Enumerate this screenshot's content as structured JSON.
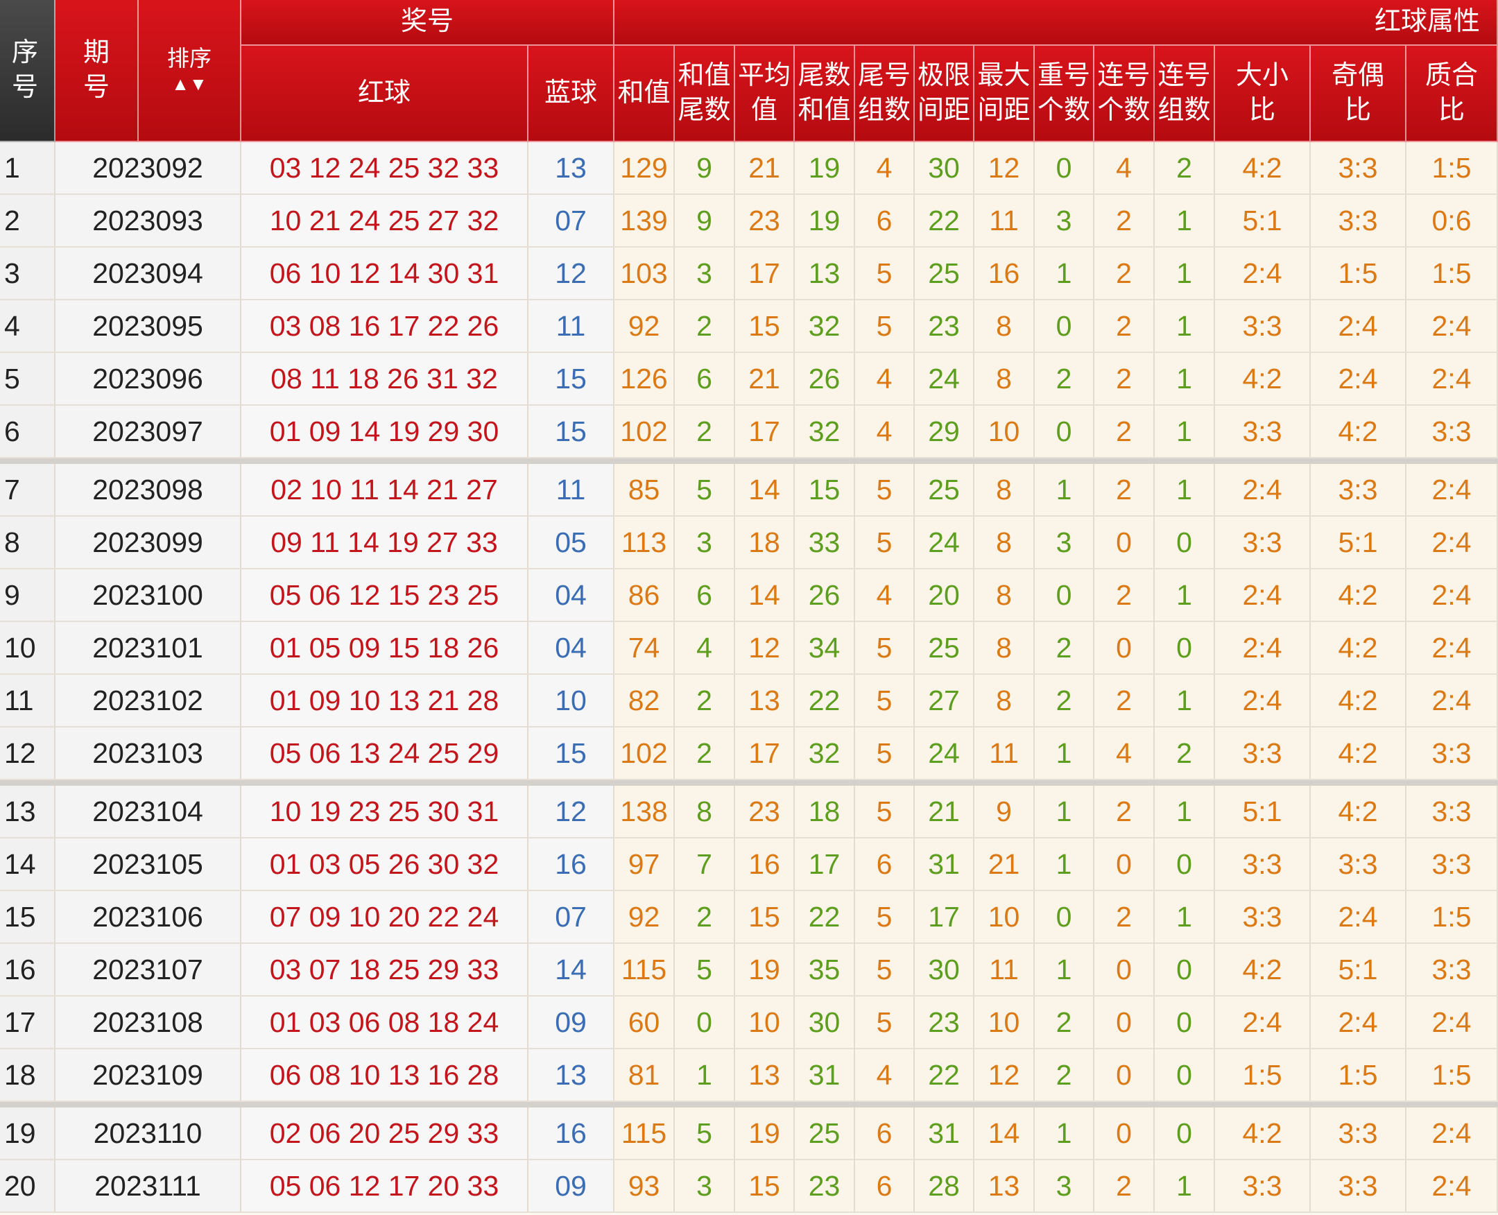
{
  "header": {
    "seq": "序号",
    "period": "期\n号",
    "sort": "排序",
    "sort_arrows": "▲▼",
    "prize": "奖号",
    "red": "红球",
    "blue": "蓝球",
    "attr_group": "红球属性",
    "attr_cols": [
      "和值",
      "和值\n尾数",
      "平均\n值",
      "尾数\n和值",
      "尾号\n组数",
      "极限\n间距",
      "最大\n间距",
      "重号\n个数",
      "连号\n个数",
      "连号\n组数",
      "大小\n比",
      "奇偶\n比",
      "质合\n比"
    ]
  },
  "rows": [
    {
      "seq": "1",
      "period": "2023092",
      "red": "03 12 24 25 32 33",
      "blue": "13",
      "attrs": [
        "129",
        "9",
        "21",
        "19",
        "4",
        "30",
        "12",
        "0",
        "4",
        "2",
        "4:2",
        "3:3",
        "1:5"
      ]
    },
    {
      "seq": "2",
      "period": "2023093",
      "red": "10 21 24 25 27 32",
      "blue": "07",
      "attrs": [
        "139",
        "9",
        "23",
        "19",
        "6",
        "22",
        "11",
        "3",
        "2",
        "1",
        "5:1",
        "3:3",
        "0:6"
      ]
    },
    {
      "seq": "3",
      "period": "2023094",
      "red": "06 10 12 14 30 31",
      "blue": "12",
      "attrs": [
        "103",
        "3",
        "17",
        "13",
        "5",
        "25",
        "16",
        "1",
        "2",
        "1",
        "2:4",
        "1:5",
        "1:5"
      ]
    },
    {
      "seq": "4",
      "period": "2023095",
      "red": "03 08 16 17 22 26",
      "blue": "11",
      "attrs": [
        "92",
        "2",
        "15",
        "32",
        "5",
        "23",
        "8",
        "0",
        "2",
        "1",
        "3:3",
        "2:4",
        "2:4"
      ]
    },
    {
      "seq": "5",
      "period": "2023096",
      "red": "08 11 18 26 31 32",
      "blue": "15",
      "attrs": [
        "126",
        "6",
        "21",
        "26",
        "4",
        "24",
        "8",
        "2",
        "2",
        "1",
        "4:2",
        "2:4",
        "2:4"
      ]
    },
    {
      "seq": "6",
      "period": "2023097",
      "red": "01 09 14 19 29 30",
      "blue": "15",
      "attrs": [
        "102",
        "2",
        "17",
        "32",
        "4",
        "29",
        "10",
        "0",
        "2",
        "1",
        "3:3",
        "4:2",
        "3:3"
      ]
    },
    {
      "seq": "7",
      "period": "2023098",
      "red": "02 10 11 14 21 27",
      "blue": "11",
      "attrs": [
        "85",
        "5",
        "14",
        "15",
        "5",
        "25",
        "8",
        "1",
        "2",
        "1",
        "2:4",
        "3:3",
        "2:4"
      ]
    },
    {
      "seq": "8",
      "period": "2023099",
      "red": "09 11 14 19 27 33",
      "blue": "05",
      "attrs": [
        "113",
        "3",
        "18",
        "33",
        "5",
        "24",
        "8",
        "3",
        "0",
        "0",
        "3:3",
        "5:1",
        "2:4"
      ]
    },
    {
      "seq": "9",
      "period": "2023100",
      "red": "05 06 12 15 23 25",
      "blue": "04",
      "attrs": [
        "86",
        "6",
        "14",
        "26",
        "4",
        "20",
        "8",
        "0",
        "2",
        "1",
        "2:4",
        "4:2",
        "2:4"
      ]
    },
    {
      "seq": "10",
      "period": "2023101",
      "red": "01 05 09 15 18 26",
      "blue": "04",
      "attrs": [
        "74",
        "4",
        "12",
        "34",
        "5",
        "25",
        "8",
        "2",
        "0",
        "0",
        "2:4",
        "4:2",
        "2:4"
      ]
    },
    {
      "seq": "11",
      "period": "2023102",
      "red": "01 09 10 13 21 28",
      "blue": "10",
      "attrs": [
        "82",
        "2",
        "13",
        "22",
        "5",
        "27",
        "8",
        "2",
        "2",
        "1",
        "2:4",
        "4:2",
        "2:4"
      ]
    },
    {
      "seq": "12",
      "period": "2023103",
      "red": "05 06 13 24 25 29",
      "blue": "15",
      "attrs": [
        "102",
        "2",
        "17",
        "32",
        "5",
        "24",
        "11",
        "1",
        "4",
        "2",
        "3:3",
        "4:2",
        "3:3"
      ]
    },
    {
      "seq": "13",
      "period": "2023104",
      "red": "10 19 23 25 30 31",
      "blue": "12",
      "attrs": [
        "138",
        "8",
        "23",
        "18",
        "5",
        "21",
        "9",
        "1",
        "2",
        "1",
        "5:1",
        "4:2",
        "3:3"
      ]
    },
    {
      "seq": "14",
      "period": "2023105",
      "red": "01 03 05 26 30 32",
      "blue": "16",
      "attrs": [
        "97",
        "7",
        "16",
        "17",
        "6",
        "31",
        "21",
        "1",
        "0",
        "0",
        "3:3",
        "3:3",
        "3:3"
      ]
    },
    {
      "seq": "15",
      "period": "2023106",
      "red": "07 09 10 20 22 24",
      "blue": "07",
      "attrs": [
        "92",
        "2",
        "15",
        "22",
        "5",
        "17",
        "10",
        "0",
        "2",
        "1",
        "3:3",
        "2:4",
        "1:5"
      ]
    },
    {
      "seq": "16",
      "period": "2023107",
      "red": "03 07 18 25 29 33",
      "blue": "14",
      "attrs": [
        "115",
        "5",
        "19",
        "35",
        "5",
        "30",
        "11",
        "1",
        "0",
        "0",
        "4:2",
        "5:1",
        "3:3"
      ]
    },
    {
      "seq": "17",
      "period": "2023108",
      "red": "01 03 06 08 18 24",
      "blue": "09",
      "attrs": [
        "60",
        "0",
        "10",
        "30",
        "5",
        "23",
        "10",
        "2",
        "0",
        "0",
        "2:4",
        "2:4",
        "2:4"
      ]
    },
    {
      "seq": "18",
      "period": "2023109",
      "red": "06 08 10 13 16 28",
      "blue": "13",
      "attrs": [
        "81",
        "1",
        "13",
        "31",
        "4",
        "22",
        "12",
        "2",
        "0",
        "0",
        "1:5",
        "1:5",
        "1:5"
      ]
    },
    {
      "seq": "19",
      "period": "2023110",
      "red": "02 06 20 25 29 33",
      "blue": "16",
      "attrs": [
        "115",
        "5",
        "19",
        "25",
        "6",
        "31",
        "14",
        "1",
        "0",
        "0",
        "4:2",
        "3:3",
        "2:4"
      ]
    },
    {
      "seq": "20",
      "period": "2023111",
      "red": "05 06 12 17 20 33",
      "blue": "09",
      "attrs": [
        "93",
        "3",
        "15",
        "23",
        "6",
        "28",
        "13",
        "3",
        "2",
        "1",
        "3:3",
        "3:3",
        "2:4"
      ]
    }
  ],
  "colors": {
    "header_red": "#c50e15",
    "red_number": "#c2161c",
    "blue_number": "#3a6db3",
    "attr_orange": "#db7a15",
    "attr_green": "#5e9e1e"
  }
}
